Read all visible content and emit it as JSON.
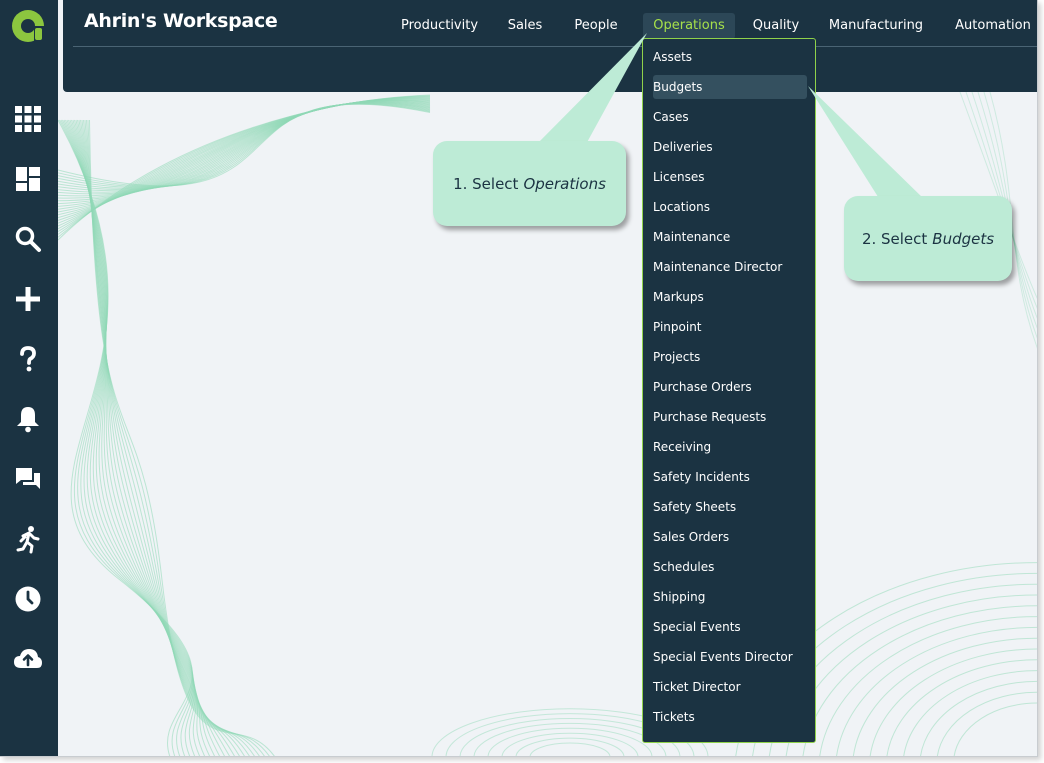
{
  "workspace": {
    "title": "Ahrin's Workspace"
  },
  "nav": {
    "items": [
      {
        "label": "Productivity",
        "active": false
      },
      {
        "label": "Sales",
        "active": false
      },
      {
        "label": "People",
        "active": false
      },
      {
        "label": "Operations",
        "active": true
      },
      {
        "label": "Quality",
        "active": false
      },
      {
        "label": "Manufacturing",
        "active": false
      },
      {
        "label": "Automation",
        "active": false
      }
    ]
  },
  "dropdown": {
    "highlighted": "Budgets",
    "items": [
      "Assets",
      "Budgets",
      "Cases",
      "Deliveries",
      "Licenses",
      "Locations",
      "Maintenance",
      "Maintenance Director",
      "Markups",
      "Pinpoint",
      "Projects",
      "Purchase Orders",
      "Purchase Requests",
      "Receiving",
      "Safety Incidents",
      "Safety Sheets",
      "Sales Orders",
      "Schedules",
      "Shipping",
      "Special Events",
      "Special Events Director",
      "Ticket Director",
      "Tickets"
    ]
  },
  "callouts": {
    "step1": {
      "prefix": "1. Select",
      "target": "Operations"
    },
    "step2": {
      "prefix": "2. Select",
      "target": "Budgets"
    }
  },
  "rail": {
    "icons": [
      "apps-grid-icon",
      "dashboard-icon",
      "search-icon",
      "add-icon",
      "help-icon",
      "bell-icon",
      "chat-icon",
      "activity-run-icon",
      "clock-icon",
      "cloud-upload-icon"
    ]
  },
  "colors": {
    "rail_bg": "#1b3342",
    "accent": "#a6e04a",
    "callout_bg": "#bdebd6",
    "page_bg": "#f0f3f6"
  }
}
